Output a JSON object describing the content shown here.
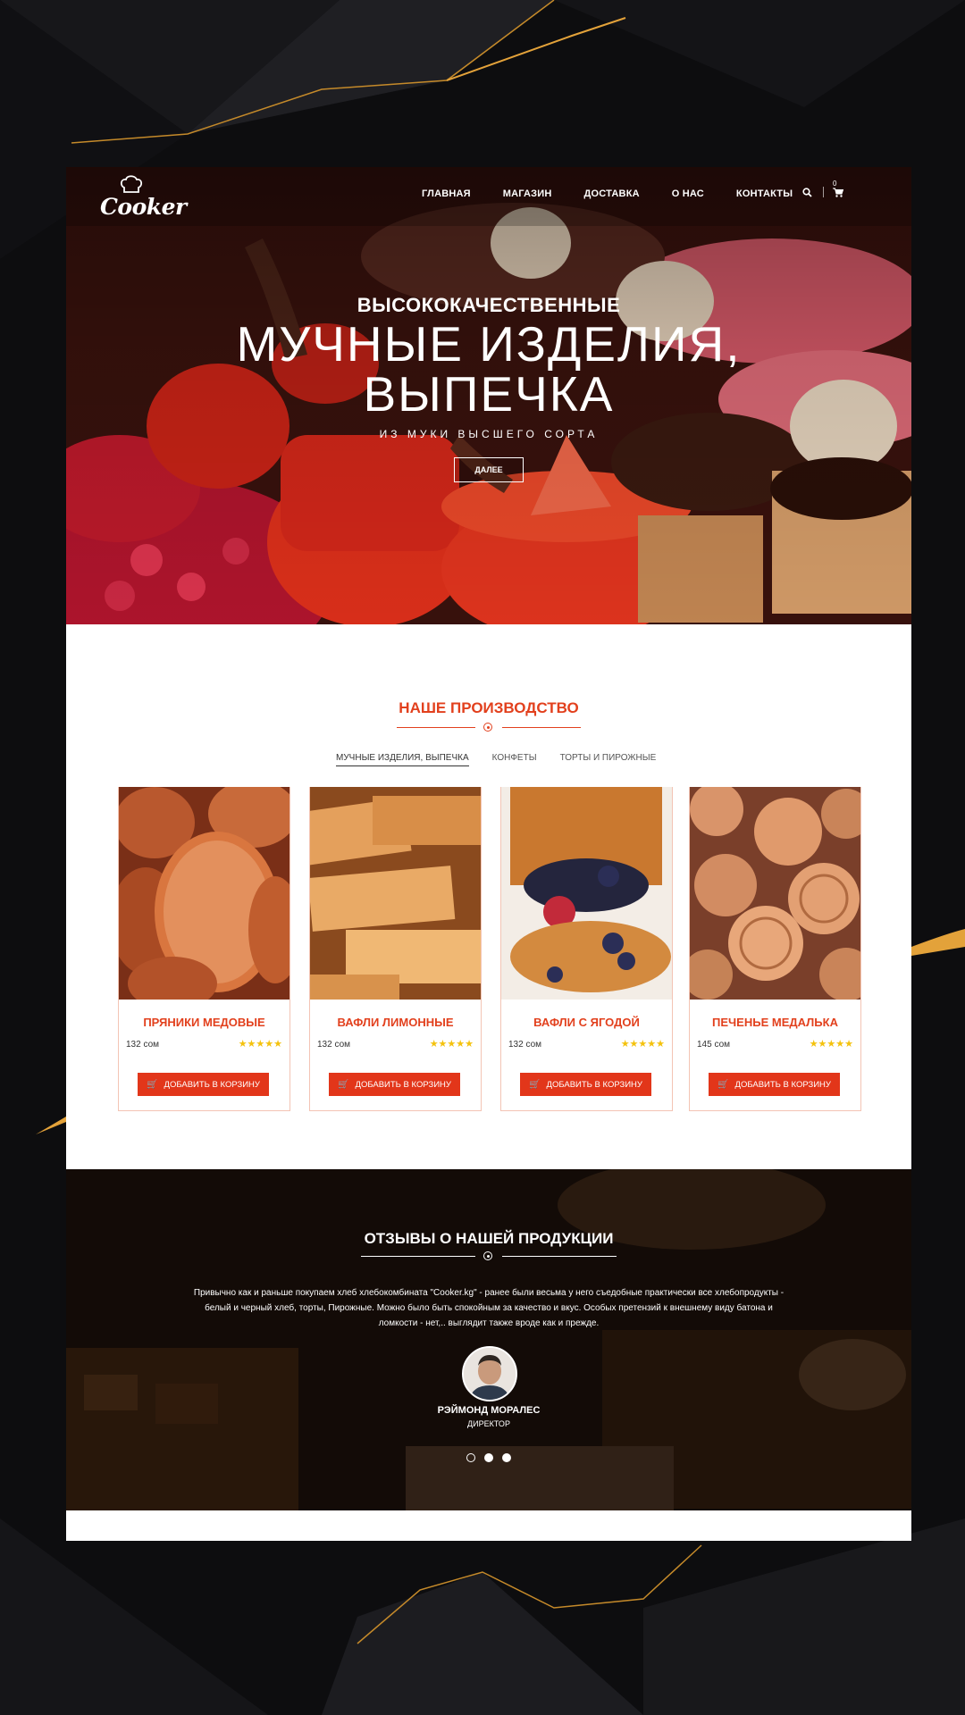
{
  "brand": {
    "logo_text": "Cooker"
  },
  "nav": {
    "items": [
      "ГЛАВНАЯ",
      "МАГАЗИН",
      "ДОСТАВКА",
      "О НАС",
      "КОНТАКТЫ"
    ],
    "cart_count": "0",
    "icons": [
      "search-icon",
      "cart-icon"
    ]
  },
  "hero": {
    "subtitle": "ВЫСОКОКАЧЕСТВЕННЫЕ",
    "title_line1": "МУЧНЫЕ ИЗДЕЛИЯ,",
    "title_line2": "ВЫПЕЧКА",
    "tagline": "ИЗ МУКИ ВЫСШЕГО СОРТА",
    "button": "ДАЛЕЕ"
  },
  "production": {
    "title": "НАШЕ ПРОИЗВОДСТВО",
    "tabs": [
      "МУЧНЫЕ ИЗДЕЛИЯ, ВЫПЕЧКА",
      "КОНФЕТЫ",
      "ТОРТЫ И ПИРОЖНЫЕ"
    ],
    "active_tab": 0,
    "products": [
      {
        "name": "ПРЯНИКИ МЕДОВЫЕ",
        "price": "132 сом",
        "rating": 5,
        "button": "ДОБАВИТЬ В КОРЗИНУ"
      },
      {
        "name": "ВАФЛИ ЛИМОННЫЕ",
        "price": "132 сом",
        "rating": 5,
        "button": "ДОБАВИТЬ В КОРЗИНУ"
      },
      {
        "name": "ВАФЛИ С ЯГОДОЙ",
        "price": "132 сом",
        "rating": 5,
        "button": "ДОБАВИТЬ В КОРЗИНУ"
      },
      {
        "name": "ПЕЧЕНЬЕ МЕДАЛЬКА",
        "price": "145 сом",
        "rating": 5,
        "button": "ДОБАВИТЬ В КОРЗИНУ"
      }
    ],
    "stars": "★★★★★"
  },
  "reviews": {
    "title": "ОТЗЫВЫ О НАШЕЙ ПРОДУКЦИИ",
    "text_line1": "Привычно как и раньше покупаем хлеб хлебокомбината \"Cooker.kg\" - ранее были весьма у него съедобные практически все хлебопродукты -",
    "text_line2": "белый и черный хлеб, торты, Пирожные. Можно было быть спокойным за качество и вкус. Особых претензий к внешнему виду батона и",
    "text_line3": "ломкости - нет,.. выглядит также вроде как и прежде.",
    "author": "РЭЙМОНД МОРАЛЕС",
    "role": "ДИРЕКТОР",
    "slides": 3,
    "active_slide": 0
  },
  "colors": {
    "accent": "#e2401d",
    "button": "#e2361a",
    "star": "#f4c20d",
    "bg": "#0d0d0f"
  }
}
